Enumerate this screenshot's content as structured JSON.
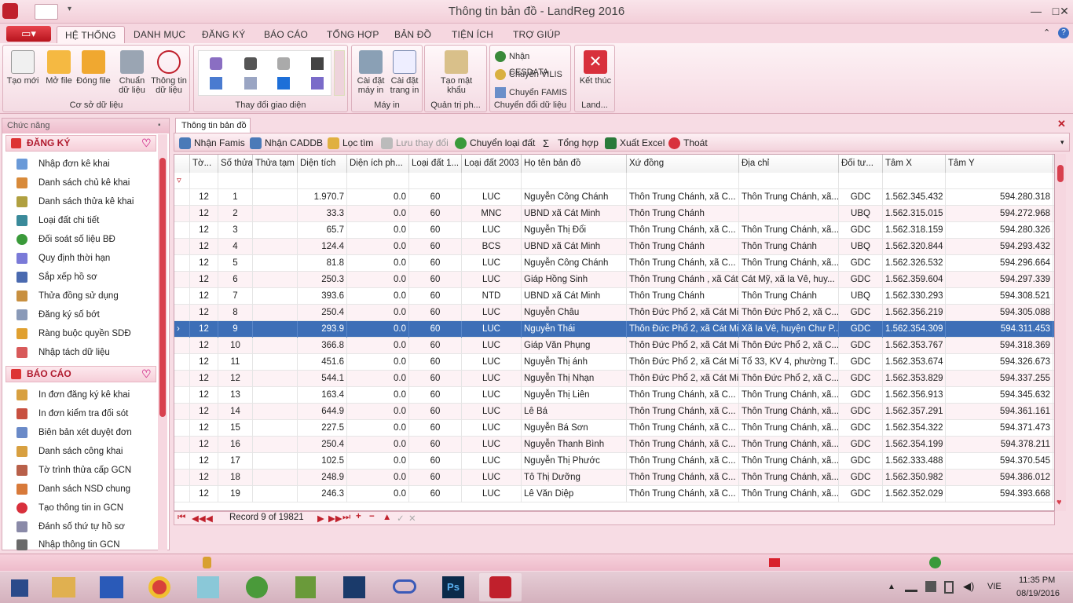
{
  "window": {
    "title": "Thông tin bản đồ - LandReg 2016"
  },
  "menu": {
    "tabs": [
      "HỆ THỐNG",
      "DANH MỤC",
      "ĐĂNG KÝ",
      "BÁO CÁO",
      "TỔNG HỢP",
      "BẢN ĐỒ",
      "TIỆN ÍCH",
      "TRỢ GIÚP"
    ]
  },
  "ribbon": {
    "csdl": {
      "label": "Cơ sở dữ liệu",
      "buttons": [
        "Tạo mới",
        "Mở file",
        "Đóng file",
        "Chuẩn dữ liệu",
        "Thông tin dữ liệu"
      ]
    },
    "giaodien": {
      "label": "Thay đổi giao diện"
    },
    "mayin": {
      "label": "Máy in",
      "buttons": [
        "Cài đặt máy in",
        "Cài đặt trang in"
      ]
    },
    "quantri": {
      "label": "Quản trị ph...",
      "button": "Tạo mật khẩu"
    },
    "chuyendoi": {
      "label": "Chuyển đổi dữ liệu",
      "items": [
        "Nhận CESDATA",
        "Chuyển VILIS",
        "Chuyển FAMIS"
      ]
    },
    "land": {
      "label": "Land...",
      "button": "Kết thúc"
    }
  },
  "sidebar": {
    "header": "Chức năng",
    "dangky": {
      "title": "ĐĂNG KÝ",
      "items": [
        "Nhập đơn kê khai",
        "Danh sách chủ kê khai",
        "Danh sách thửa kê khai",
        "Loại đất chi tiết",
        "Đối soát số liệu BĐ",
        "Quy định thời hạn",
        "Sắp xếp hồ sơ",
        "Thửa đồng sử dụng",
        "Đăng ký số bớt",
        "Ràng buộc quyền SDĐ",
        "Nhập tách dữ liệu"
      ]
    },
    "baocao": {
      "title": "BÁO CÁO",
      "items": [
        "In đơn đăng ký kê khai",
        "In đơn kiểm tra đối sót",
        "Biên bản xét duyệt đơn",
        "Danh sách công khai",
        "Tờ trình thửa cấp GCN",
        "Danh sách NSD chung",
        "Tạo thông tin in GCN",
        "Đánh số thứ tự hồ sơ",
        "Nhập thông tin GCN"
      ]
    }
  },
  "document": {
    "tab": "Thông tin bản đồ"
  },
  "toolbar": {
    "buttons": [
      "Nhận Famis",
      "Nhận CADDB",
      "Lọc tìm",
      "Lưu thay đổi",
      "Chuyển loại đất",
      "Tổng hợp",
      "Xuất Excel",
      "Thoát"
    ]
  },
  "grid": {
    "columns": [
      "Tờ...",
      "Số thửa",
      "Thửa tạm",
      "Diện tích",
      "Diện ích ph...",
      "Loại đất 1...",
      "Loại đất 2003",
      "Họ tên bản đồ",
      "Xứ đồng",
      "Địa chỉ",
      "Đối tư...",
      "Tâm X",
      "Tâm Y"
    ],
    "rows": [
      [
        "12",
        "1",
        "",
        "1.970.7",
        "0.0",
        "60",
        "LUC",
        "Nguyễn Công Chánh",
        "Thôn Trung Chánh, xã C...",
        "Thôn Trung Chánh, xã...",
        "GDC",
        "1.562.345.432",
        "594.280.318"
      ],
      [
        "12",
        "2",
        "",
        "33.3",
        "0.0",
        "60",
        "MNC",
        "UBND xã Cát Minh",
        "Thôn Trung Chánh",
        "",
        "UBQ",
        "1.562.315.015",
        "594.272.968"
      ],
      [
        "12",
        "3",
        "",
        "65.7",
        "0.0",
        "60",
        "LUC",
        "Nguyễn Thị Đổi",
        "Thôn Trung Chánh, xã C...",
        "Thôn Trung Chánh, xã...",
        "GDC",
        "1.562.318.159",
        "594.280.326"
      ],
      [
        "12",
        "4",
        "",
        "124.4",
        "0.0",
        "60",
        "BCS",
        "UBND xã Cát Minh",
        "Thôn Trung Chánh",
        "Thôn Trung Chánh",
        "UBQ",
        "1.562.320.844",
        "594.293.432"
      ],
      [
        "12",
        "5",
        "",
        "81.8",
        "0.0",
        "60",
        "LUC",
        "Nguyễn Công Chánh",
        "Thôn Trung Chánh, xã C...",
        "Thôn Trung Chánh, xã...",
        "GDC",
        "1.562.326.532",
        "594.296.664"
      ],
      [
        "12",
        "6",
        "",
        "250.3",
        "0.0",
        "60",
        "LUC",
        "Giáp Hồng Sinh",
        "Thôn Trung Chánh , xã Cát",
        "Cát Mỹ, xã Ia Vê, huy...",
        "GDC",
        "1.562.359.604",
        "594.297.339"
      ],
      [
        "12",
        "7",
        "",
        "393.6",
        "0.0",
        "60",
        "NTD",
        "UBND xã Cát Minh",
        "Thôn Trung Chánh",
        "Thôn Trung Chánh",
        "UBQ",
        "1.562.330.293",
        "594.308.521"
      ],
      [
        "12",
        "8",
        "",
        "250.4",
        "0.0",
        "60",
        "LUC",
        "Nguyễn Châu",
        "Thôn Đức Phổ 2, xã Cát Min",
        "Thôn Đức Phổ 2, xã C...",
        "GDC",
        "1.562.356.219",
        "594.305.088"
      ],
      [
        "12",
        "9",
        "",
        "293.9",
        "0.0",
        "60",
        "LUC",
        "Nguyễn Thái",
        "Thôn Đức Phổ 2, xã Cát Min",
        "Xã Ia Vê, huyện Chư P...",
        "GDC",
        "1.562.354.309",
        "594.311.453"
      ],
      [
        "12",
        "10",
        "",
        "366.8",
        "0.0",
        "60",
        "LUC",
        "Giáp Văn Phụng",
        "Thôn Đức Phổ 2, xã Cát Min",
        "Thôn Đức Phổ 2, xã C...",
        "GDC",
        "1.562.353.767",
        "594.318.369"
      ],
      [
        "12",
        "11",
        "",
        "451.6",
        "0.0",
        "60",
        "LUC",
        "Nguyễn Thị ánh",
        "Thôn Đức Phổ 2, xã Cát Min",
        "Tổ 33, KV 4, phường T...",
        "GDC",
        "1.562.353.674",
        "594.326.673"
      ],
      [
        "12",
        "12",
        "",
        "544.1",
        "0.0",
        "60",
        "LUC",
        "Nguyễn Thị Nhạn",
        "Thôn Đức Phổ 2, xã Cát Min",
        "Thôn Đức Phổ 2, xã C...",
        "GDC",
        "1.562.353.829",
        "594.337.255"
      ],
      [
        "12",
        "13",
        "",
        "163.4",
        "0.0",
        "60",
        "LUC",
        "Nguyễn Thị Liên",
        "Thôn Trung Chánh, xã C...",
        "Thôn Trung Chánh, xã...",
        "GDC",
        "1.562.356.913",
        "594.345.632"
      ],
      [
        "12",
        "14",
        "",
        "644.9",
        "0.0",
        "60",
        "LUC",
        "Lê Bá",
        "Thôn Trung Chánh, xã C...",
        "Thôn Trung Chánh, xã...",
        "GDC",
        "1.562.357.291",
        "594.361.161"
      ],
      [
        "12",
        "15",
        "",
        "227.5",
        "0.0",
        "60",
        "LUC",
        "Nguyễn Bá Sơn",
        "Thôn Trung Chánh, xã C...",
        "Thôn Trung Chánh, xã...",
        "GDC",
        "1.562.354.322",
        "594.371.473"
      ],
      [
        "12",
        "16",
        "",
        "250.4",
        "0.0",
        "60",
        "LUC",
        "Nguyễn Thanh Bình",
        "Thôn Trung Chánh, xã C...",
        "Thôn Trung Chánh, xã...",
        "GDC",
        "1.562.354.199",
        "594.378.211"
      ],
      [
        "12",
        "17",
        "",
        "102.5",
        "0.0",
        "60",
        "LUC",
        "Nguyễn Thị Phước",
        "Thôn Trung Chánh, xã C...",
        "Thôn Trung Chánh, xã...",
        "GDC",
        "1.562.333.488",
        "594.370.545"
      ],
      [
        "12",
        "18",
        "",
        "248.9",
        "0.0",
        "60",
        "LUC",
        "Tô Thị Dưỡng",
        "Thôn Trung Chánh, xã C...",
        "Thôn Trung Chánh, xã...",
        "GDC",
        "1.562.350.982",
        "594.386.012"
      ],
      [
        "12",
        "19",
        "",
        "246.3",
        "0.0",
        "60",
        "LUC",
        "Lê Văn Diệp",
        "Thôn Trung Chánh, xã C...",
        "Thôn Trung Chánh, xã...",
        "GDC",
        "1.562.352.029",
        "594.393.668"
      ]
    ],
    "selected_row": 8
  },
  "navigator": {
    "record_text": "Record 9 of 19821"
  },
  "taskbar": {
    "lang": "VIE",
    "time": "11:35 PM",
    "date": "08/19/2016"
  }
}
